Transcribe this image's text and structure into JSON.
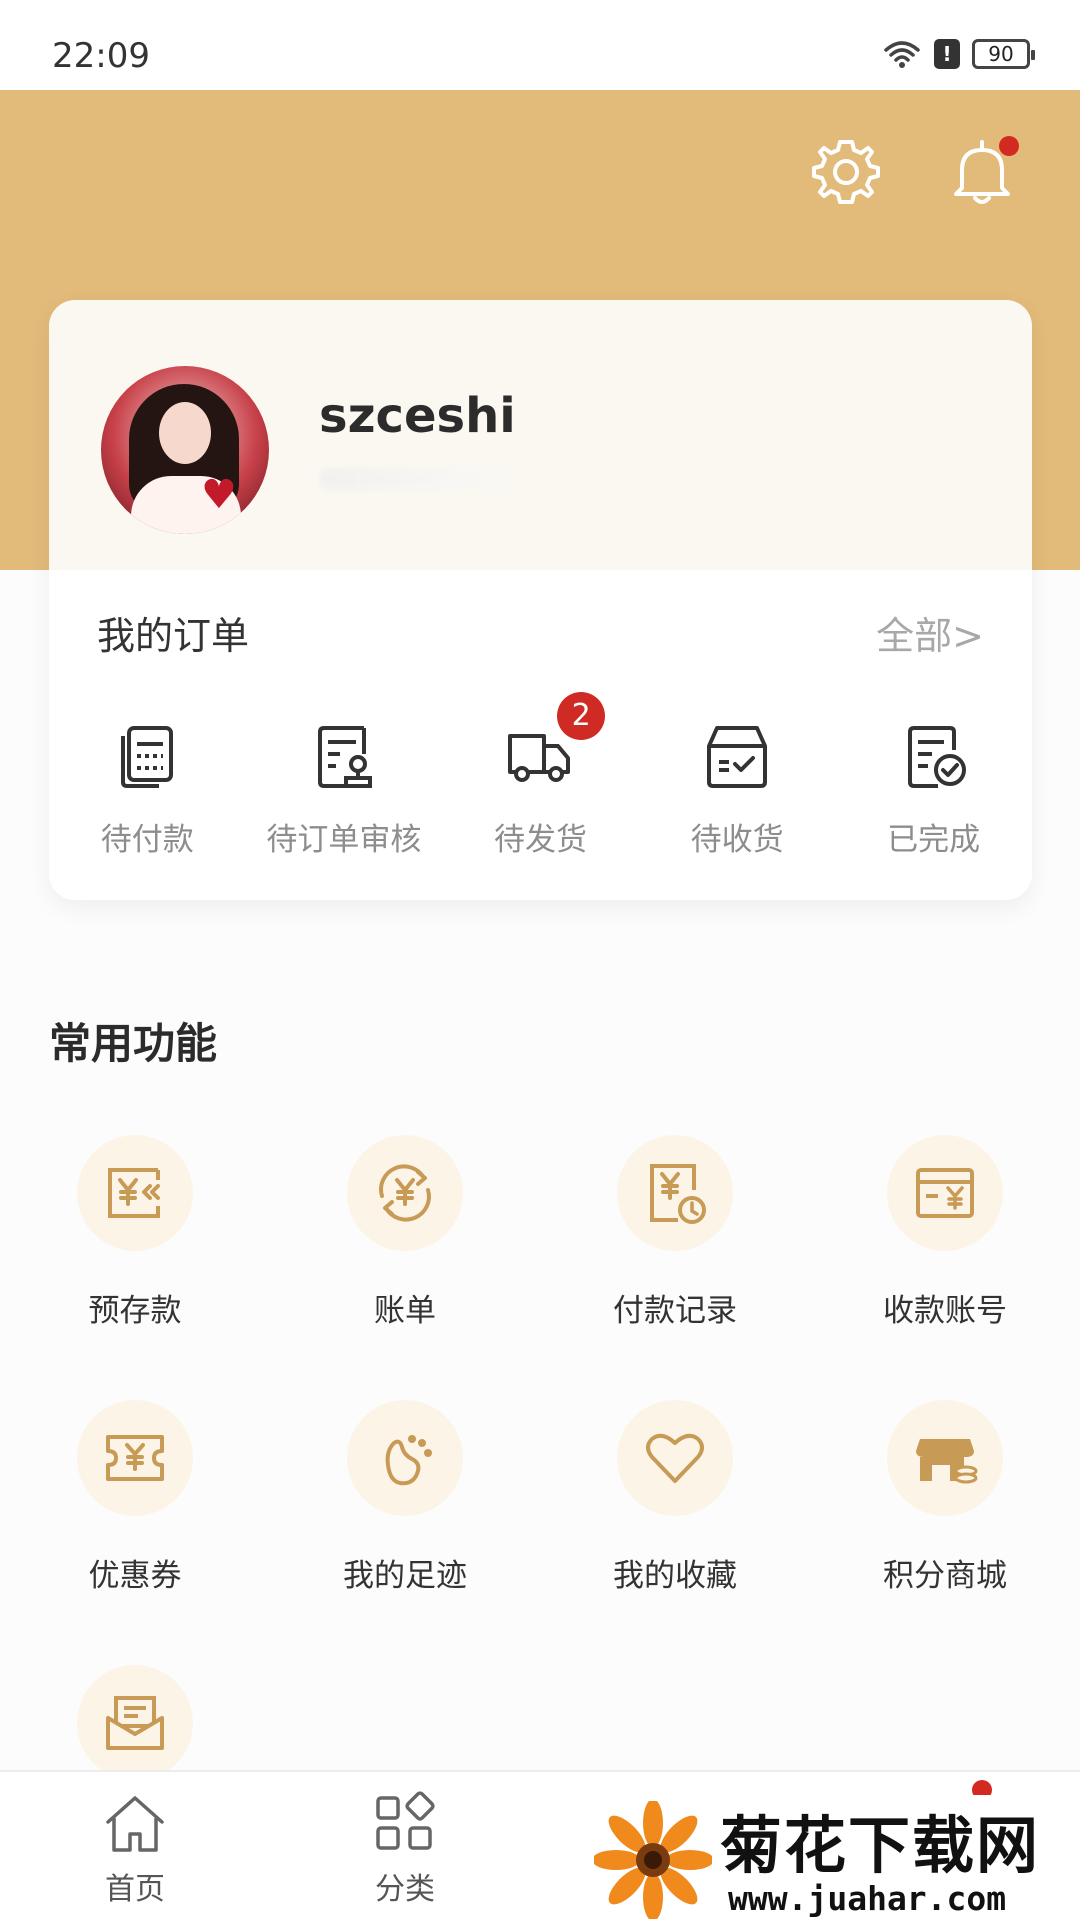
{
  "status_bar": {
    "time": "22:09",
    "battery": "90",
    "sim_alert": "!"
  },
  "header": {
    "settings_icon": "gear-icon",
    "notification_icon": "bell-icon",
    "has_notification": true
  },
  "profile": {
    "username": "szceshi"
  },
  "orders": {
    "title": "我的订单",
    "all_link": "全部>",
    "items": [
      {
        "label": "待付款",
        "icon": "clipboard-list-icon"
      },
      {
        "label": "待订单审核",
        "icon": "document-stamp-icon"
      },
      {
        "label": "待发货",
        "icon": "truck-icon",
        "badge": "2"
      },
      {
        "label": "待收货",
        "icon": "inbox-check-icon"
      },
      {
        "label": "已完成",
        "icon": "document-check-icon"
      }
    ]
  },
  "functions": {
    "title": "常用功能",
    "items": [
      {
        "label": "预存款",
        "icon": "prepaid-yen-icon"
      },
      {
        "label": "账单",
        "icon": "bill-refresh-yen-icon"
      },
      {
        "label": "付款记录",
        "icon": "payment-record-icon"
      },
      {
        "label": "收款账号",
        "icon": "receiving-card-icon"
      },
      {
        "label": "优惠券",
        "icon": "coupon-icon"
      },
      {
        "label": "我的足迹",
        "icon": "footprint-icon"
      },
      {
        "label": "我的收藏",
        "icon": "heart-icon"
      },
      {
        "label": "积分商城",
        "icon": "points-store-icon"
      },
      {
        "label": "",
        "icon": "mail-icon"
      }
    ]
  },
  "tabbar": {
    "items": [
      {
        "label": "首页",
        "icon": "home-icon"
      },
      {
        "label": "分类",
        "icon": "category-grid-icon"
      }
    ]
  },
  "watermark": {
    "title": "菊花下载网",
    "url": "www.juahar.com"
  },
  "colors": {
    "header_bg": "#e2bb7a",
    "accent_gold": "#c79a55",
    "badge_red": "#d02a24",
    "card_bg": "#fbf8f1",
    "icon_bg": "#fcf4e7"
  }
}
